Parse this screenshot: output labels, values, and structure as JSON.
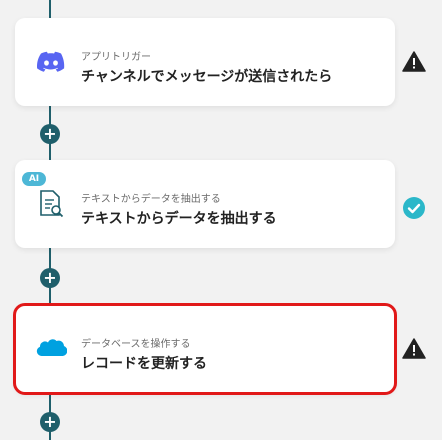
{
  "steps": [
    {
      "category": "アプリトリガー",
      "title": "チャンネルでメッセージが送信されたら",
      "icon": "discord-icon",
      "status": "warning"
    },
    {
      "category": "テキストからデータを抽出する",
      "title": "テキストからデータを抽出する",
      "icon": "document-search-icon",
      "status": "complete",
      "badge": "AI"
    },
    {
      "category": "データベースを操作する",
      "title": "レコードを更新する",
      "icon": "salesforce-cloud-icon",
      "status": "warning"
    }
  ],
  "add_step_label": "+",
  "colors": {
    "connector": "#1f5f6b",
    "warning": "#222222",
    "complete": "#2bb7c9",
    "selection": "#e11919",
    "ai_badge": "#4db7d6",
    "discord": "#5865f2",
    "salesforce": "#00a1e0"
  }
}
